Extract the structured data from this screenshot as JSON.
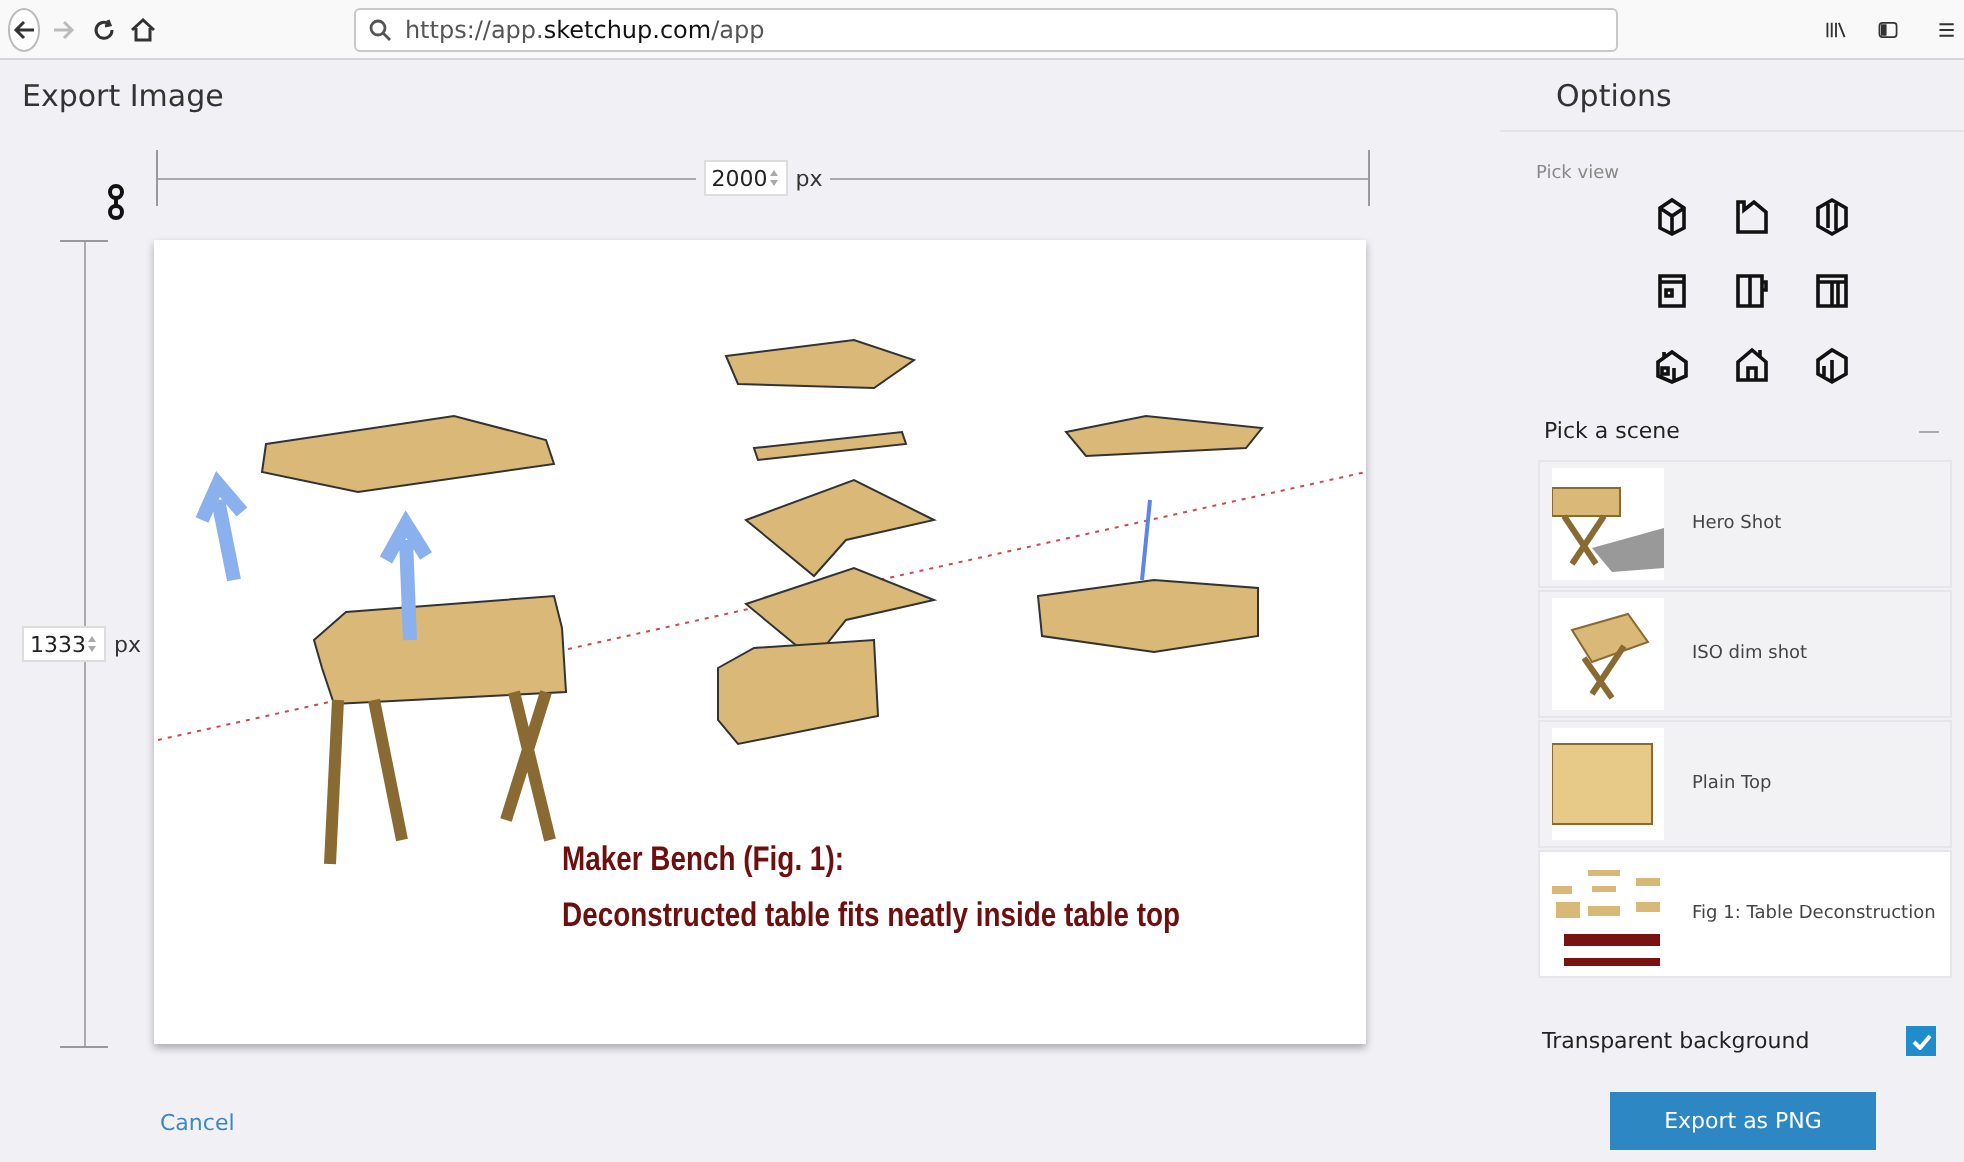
{
  "browser": {
    "url": "https://app.**sketchup.com**/app",
    "back_disabled": false,
    "forward_disabled": true
  },
  "export": {
    "title": "Export Image",
    "width_value": "2000",
    "width_unit": "px",
    "height_value": "1333",
    "height_unit": "px",
    "locked": true,
    "caption": [
      "Maker Bench (Fig. 1):",
      "Deconstructed table fits neatly inside table top"
    ],
    "cancel": "Cancel"
  },
  "options": {
    "title": "Options",
    "pick_view_label": "Pick view",
    "scenes_label": "Pick a scene",
    "scenes_toggle": "—",
    "scenes": [
      {
        "name": "Hero Shot",
        "selected": false,
        "kind": "hero"
      },
      {
        "name": "ISO dim shot",
        "selected": false,
        "kind": "iso"
      },
      {
        "name": "Plain Top",
        "selected": false,
        "kind": "top"
      },
      {
        "name": "Fig 1: Table Deconstruction",
        "selected": true,
        "kind": "fig"
      }
    ],
    "transparent": {
      "label": "Transparent background",
      "checked": true
    },
    "export_button": "Export as PNG"
  }
}
